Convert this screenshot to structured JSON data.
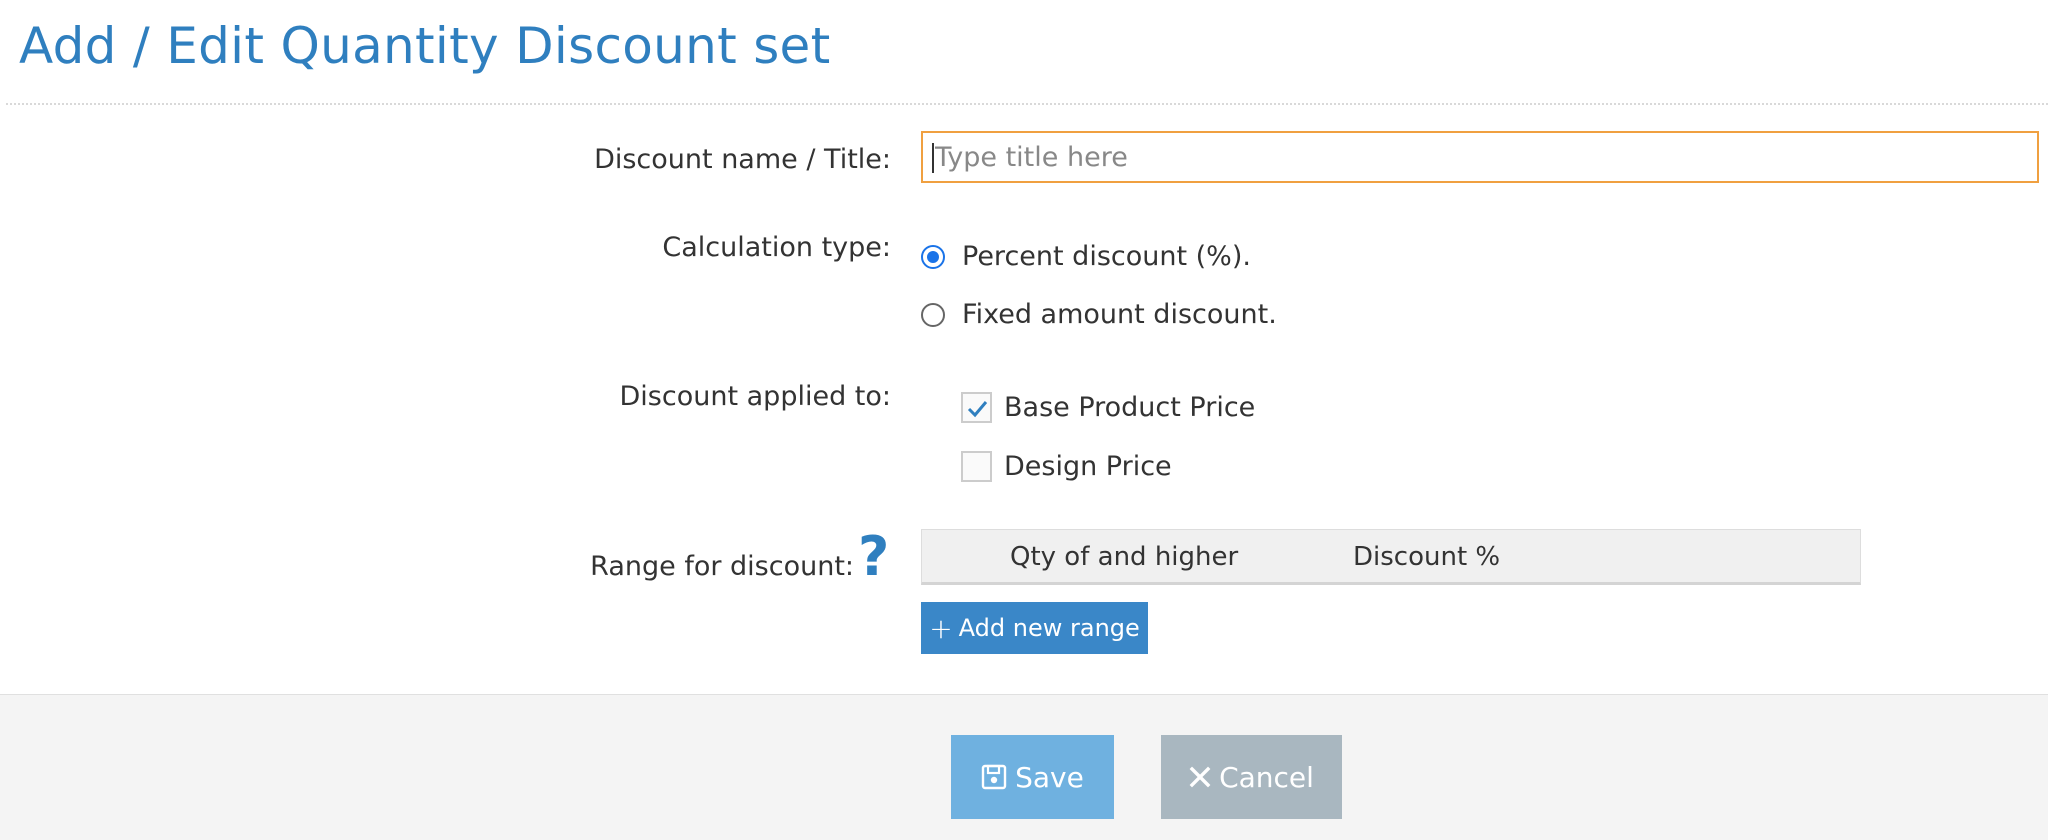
{
  "page": {
    "title": "Add / Edit Quantity Discount set"
  },
  "form": {
    "name_label": "Discount name / Title:",
    "name_placeholder": "Type title here",
    "name_value": "",
    "calc_label": "Calculation type:",
    "calc_options": [
      {
        "label": "Percent discount (%).",
        "selected": true
      },
      {
        "label": "Fixed amount discount.",
        "selected": false
      }
    ],
    "applied_label": "Discount applied to:",
    "applied_options": [
      {
        "label": "Base Product Price",
        "checked": true
      },
      {
        "label": "Design Price",
        "checked": false
      }
    ],
    "range_label": "Range for discount:",
    "help_glyph": "?",
    "range_columns": [
      "Qty of and higher",
      "Discount %"
    ],
    "add_range_label": "Add new range",
    "add_range_icon": "plus-icon"
  },
  "footer": {
    "save_label": "Save",
    "save_icon": "floppy-disk-icon",
    "cancel_label": "Cancel",
    "cancel_icon": "close-icon"
  },
  "colors": {
    "accent": "#2f7fbf",
    "focus_border": "#f0a040",
    "add_button": "#3a87c8",
    "save_button": "#6fb1e0",
    "cancel_button": "#a9b7c0",
    "radio_selected": "#1a73e8"
  }
}
